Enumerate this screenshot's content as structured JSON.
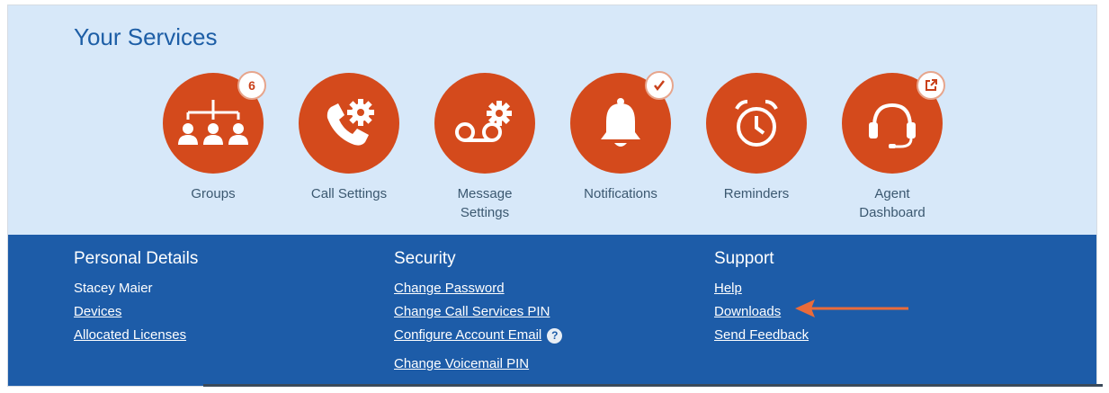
{
  "services": {
    "title": "Your Services",
    "tiles": [
      {
        "label": "Groups",
        "icon": "groups-icon",
        "badge": "6"
      },
      {
        "label": "Call Settings",
        "icon": "call-settings-icon"
      },
      {
        "label": "Message\nSettings",
        "icon": "voicemail-settings-icon"
      },
      {
        "label": "Notifications",
        "icon": "bell-icon",
        "badge_icon": "checkmark-icon"
      },
      {
        "label": "Reminders",
        "icon": "alarm-clock-icon"
      },
      {
        "label": "Agent\nDashboard",
        "icon": "headset-icon",
        "badge_icon": "external-link-icon"
      }
    ]
  },
  "personal": {
    "heading": "Personal Details",
    "name": "Stacey Maier",
    "links": [
      "Devices",
      "Allocated Licenses"
    ]
  },
  "security": {
    "heading": "Security",
    "links": [
      "Change Password",
      "Change Call Services PIN",
      "Configure Account Email",
      "Change Voicemail PIN"
    ],
    "help_glyph": "?"
  },
  "support": {
    "heading": "Support",
    "links": [
      "Help",
      "Downloads",
      "Send Feedback"
    ]
  },
  "colors": {
    "services_bg": "#d7e8f9",
    "icon_circle": "#d44a1c",
    "footer_bg": "#1d5ca8",
    "title": "#1d5ea6",
    "arrow": "#ea6b3a"
  }
}
